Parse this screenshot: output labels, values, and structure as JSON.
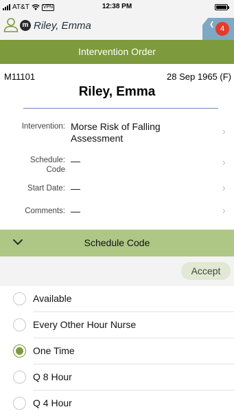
{
  "status_bar": {
    "carrier": "AT&T",
    "vpn": "VPN",
    "time": "12:38 PM"
  },
  "patient_header": {
    "badge_letter": "m",
    "name": "Riley, Emma",
    "notification_count": "4"
  },
  "title": "Intervention Order",
  "patient": {
    "mrn": "M11101",
    "dob_sex": "28 Sep 1965 (F)",
    "name": "Riley, Emma"
  },
  "fields": [
    {
      "label": "Intervention:",
      "value": "Morse Risk of Falling Assessment"
    },
    {
      "label_line1": "Schedule:",
      "label_line2": "Code",
      "value": "—"
    },
    {
      "label": "Start Date:",
      "value": "—"
    },
    {
      "label": "Comments:",
      "value": "—"
    }
  ],
  "schedule_section": {
    "title": "Schedule Code",
    "accept_label": "Accept"
  },
  "options": [
    {
      "label": "Available",
      "selected": false
    },
    {
      "label": "Every Other Hour Nurse",
      "selected": false
    },
    {
      "label": "One Time",
      "selected": true
    },
    {
      "label": "Q 8 Hour",
      "selected": false
    },
    {
      "label": "Q 4 Hour",
      "selected": false
    }
  ],
  "colors": {
    "primary_green": "#7d9a3c",
    "light_green": "#aec784",
    "notification_red": "#e53b2c",
    "tab_blue": "#7ea9c4"
  },
  "icons": [
    "signal-icon",
    "wifi-icon",
    "battery-icon",
    "person-icon",
    "chevron-right-icon",
    "chevron-down-icon",
    "radio-button-icon"
  ]
}
